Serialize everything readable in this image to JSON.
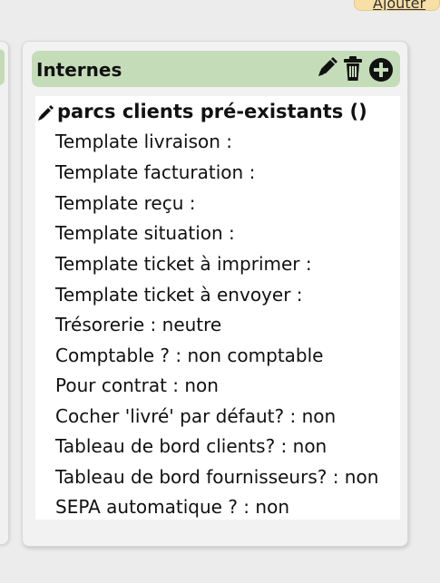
{
  "top_link_label": "Ajouter",
  "panel": {
    "title": "Internes",
    "actions": {
      "edit_icon": "pencil-icon",
      "delete_icon": "trash-icon",
      "add_icon": "plus-circle-icon"
    }
  },
  "group": {
    "title": "parcs clients pré-existants ()",
    "edit_icon": "pencil-icon"
  },
  "details": [
    "Template livraison :",
    "Template facturation :",
    "Template reçu :",
    "Template situation :",
    "Template ticket à imprimer :",
    "Template ticket à envoyer :",
    "Trésorerie : neutre",
    "Comptable ? : non comptable",
    "Pour contrat : non",
    "Cocher 'livré' par défaut? : non",
    "Tableau de bord clients? : non",
    "Tableau de bord fournisseurs? : non",
    "SEPA automatique ? : non"
  ],
  "colors": {
    "header_green": "#c5dcb9",
    "top_link_yellow": "#f7dfa6",
    "card_gray": "#f2f2f2"
  }
}
